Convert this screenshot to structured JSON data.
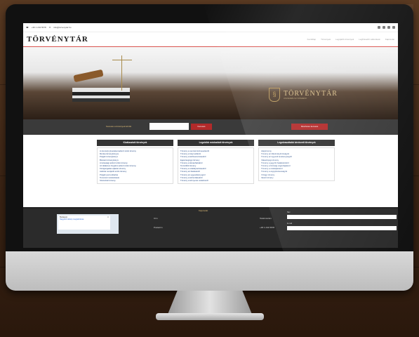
{
  "topbar": {
    "phone": "+36 1 234 5678",
    "email": "info@torvenytar.hu",
    "social_icons": [
      "rss-icon",
      "twitter-icon",
      "facebook-icon",
      "gplus-icon"
    ]
  },
  "header": {
    "logo": "TÖRVÉNYTÁR",
    "nav": [
      "Kezdőlap",
      "Törvények",
      "Legújabb törvények",
      "Legfrissebb változások",
      "Kapcsolat"
    ]
  },
  "hero": {
    "brand": "TÖRVÉNYTÁR",
    "tagline": "JOGSZABÁLYGYŰJTEMÉNY",
    "shield_icon": "§"
  },
  "search": {
    "label": "Keresés a törvények között",
    "placeholder": "",
    "button": "Keresés",
    "advanced_button": "Részletes keresés"
  },
  "columns": [
    {
      "title": "Kiválasztott törvények",
      "items": [
        "A személyi jövedelemadóról szóló törvény",
        "Munka törvénykönyve",
        "Polgári törvénykönyv",
        "Büntető törvénykönyv",
        "A társasági adóról szóló törvény",
        "Az általános forgalmi adóról szóló törvény",
        "Közigazgatási eljárási törvény",
        "Adózás rendjéről szóló törvény",
        "Polgári perrendtartás",
        "Tervezett módosítások",
        "Számviteli törvény"
      ]
    },
    {
      "title": "Legutóbb módosított törvények",
      "items": [
        "Törvény a nemzeti köznevelésről",
        "Törvény a helyi adókról",
        "Törvény a közbeszerzésekről",
        "Egészségügyi törvény",
        "Törvény a társasházakról",
        "Termőföld törvény",
        "Törvény a szabálysértésekről",
        "Törvény az illetékekről",
        "Törvény az egyesülési jogról",
        "Törvény a közterületekről",
        "Törvény a környezet védelméről"
      ]
    },
    {
      "title": "Legolvasottabb kérdezett törvények",
      "items": [
        "Alaptörvény",
        "Törvény az Alkotmánybíróságról",
        "Törvény az ügyvédi tevékenységről",
        "Választójogi törvény",
        "Törvény a jegyzői hatáskörökről",
        "Törvény a bírósági végrehajtásról",
        "Törvény a csődeljárásról",
        "Törvény a cégnyilvánosságról",
        "Vízügyi törvény",
        "Vasúti törvény"
      ]
    }
  ],
  "footer": {
    "title": "Kapcsolat",
    "map_title": "Budapest",
    "map_link": "Nagyobb térkép megtekintése",
    "city_label": "Cím",
    "address_label": "Postacím",
    "phone_label": "Telefonszám",
    "phone": "+36 1 234 5678",
    "name_label": "Név",
    "email_label": "E-mail"
  }
}
